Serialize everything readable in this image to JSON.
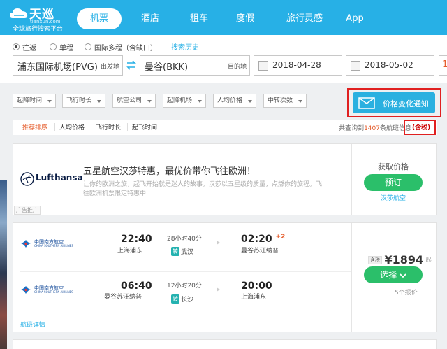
{
  "header": {
    "logo_title": "天巡",
    "logo_domain": "tianxun.com",
    "logo_slogan": "全球旅行搜索平台",
    "nav": [
      "机票",
      "酒店",
      "租车",
      "度假",
      "旅行灵感",
      "App"
    ],
    "active_nav": "机票",
    "brand_color": "#27b0e6"
  },
  "search": {
    "trip_types": [
      "往返",
      "单程",
      "国际多程（含缺口）"
    ],
    "selected_trip_type": "往返",
    "history_link": "搜索历史",
    "origin": "浦东国际机场(PVG)",
    "origin_suffix": "出发地",
    "destination": "曼谷(BKK)",
    "destination_suffix": "目的地",
    "depart_date": "2018-04-28",
    "return_date": "2018-05-02",
    "extra_field_text": "1"
  },
  "filters": [
    "起降时间",
    "飞行时长",
    "航空公司",
    "起降机场",
    "人均价格",
    "中转次数"
  ],
  "notify_button": "价格变化通知",
  "sort": {
    "options": [
      "推荐排序",
      "人均价格",
      "飞行时长",
      "起飞时间"
    ],
    "active": "推荐排序",
    "result_prefix": "共查询到",
    "result_count": "1407",
    "result_suffix": "条航班信息",
    "tax_note": "(含税)"
  },
  "ad": {
    "brand": "Lufthansa",
    "title": "五星航空汉莎特惠，最优价带你飞往欧洲！",
    "desc": "让你的欧洲之旅，起飞开始就是迷人的故事。汉莎以五星级的质量，点燃你的旅程。飞往欧洲机票限定特惠中",
    "tag": "广告推广",
    "get_price": "获取价格",
    "book_button": "预订",
    "brand_link": "汉莎航空"
  },
  "flight": {
    "airline_cn": "中国南方航空",
    "airline_en": "CHINA SOUTHERN AIRLINES",
    "outbound": {
      "depart_time": "22:40",
      "depart_place": "上海浦东",
      "duration": "28小时40分",
      "transfer_badge": "转",
      "transfer_city": "武汉",
      "arrive_time": "02:20",
      "day_offset": "+2",
      "arrive_place": "曼谷苏汪纳普"
    },
    "inbound": {
      "depart_time": "06:40",
      "depart_place": "曼谷苏汪纳普",
      "duration": "12小时20分",
      "transfer_badge": "转",
      "transfer_city": "长沙",
      "arrive_time": "20:00",
      "arrive_place": "上海浦东"
    },
    "tax_tag": "含税",
    "price": "¥1894",
    "price_unit": "起",
    "select_button": "选择",
    "seats_left": "5个报价",
    "detail_link": "航班详情"
  }
}
